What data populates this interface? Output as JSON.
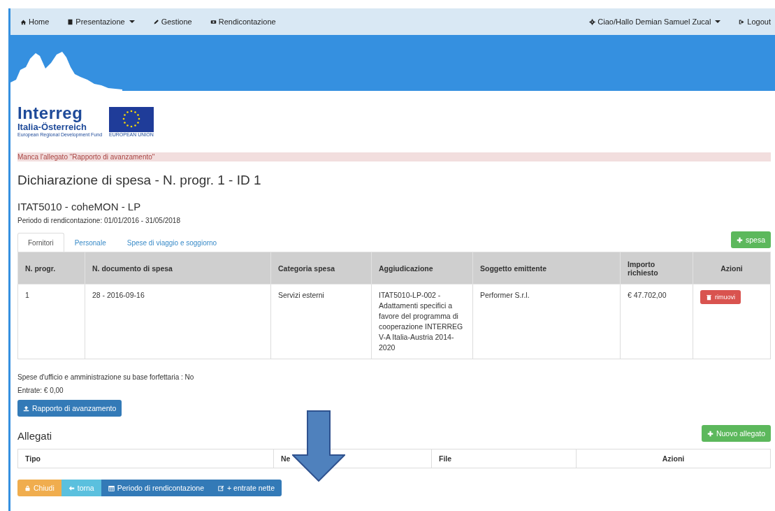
{
  "navbar": {
    "left": [
      {
        "label": "Home",
        "dropdown": false
      },
      {
        "label": "Presentazione",
        "dropdown": true
      },
      {
        "label": "Gestione",
        "dropdown": false
      },
      {
        "label": "Rendicontazione",
        "dropdown": false
      }
    ],
    "right": [
      {
        "label": "Ciao/Hallo Demian Samuel Zucal",
        "dropdown": true
      },
      {
        "label": "Logout",
        "dropdown": false
      }
    ]
  },
  "logo": {
    "name": "Interreg",
    "region": "Italia-Österreich",
    "fund": "European Regional Development Fund",
    "eu": "EUROPEAN UNION"
  },
  "alert": "Manca l'allegato \"Rapporto di avanzamento\"",
  "title": "Dichiarazione di spesa - N. progr. 1 - ID 1",
  "subtitle": "ITAT5010 - coheMON - LP",
  "period": "Periodo di rendicontazione: 01/01/2016 - 31/05/2018",
  "tabs": [
    {
      "label": "Fornitori",
      "selected": true
    },
    {
      "label": "Personale",
      "selected": false
    },
    {
      "label": "Spese di viaggio e soggiorno",
      "selected": false
    }
  ],
  "add_button": "spesa",
  "table": {
    "columns": [
      "N. progr.",
      "N. documento di spesa",
      "Categoria spesa",
      "Aggiudicazione",
      "Soggetto emittente",
      "Importo richiesto",
      "Azioni"
    ],
    "rows": [
      {
        "cells": [
          "1",
          "28 - 2016-09-16",
          "Servizi esterni",
          "ITAT5010-LP-002 - Adattamenti specifici a favore del programma di cooperazione INTERREG V-A Italia-Austria 2014-2020",
          "Performer S.r.l.",
          "€ 47.702,00"
        ],
        "action": "rimuovi"
      }
    ]
  },
  "flat_rate": "Spese d'ufficio e amministrazione su base forfettaria : No",
  "income": "Entrate: € 0,00",
  "report_button": "Rapporto di avanzamento",
  "attachments": {
    "title": "Allegati",
    "add_button": "Nuovo allegato",
    "columns": [
      "Tipo",
      "Ne",
      "File",
      "Azioni"
    ]
  },
  "footer_buttons": [
    {
      "label": "Chiudi",
      "kind": "warning"
    },
    {
      "label": "torna",
      "kind": "info"
    },
    {
      "label": "Periodo di rendicontazione",
      "kind": "primary"
    },
    {
      "label": "+ entrate nette",
      "kind": "primary"
    }
  ]
}
